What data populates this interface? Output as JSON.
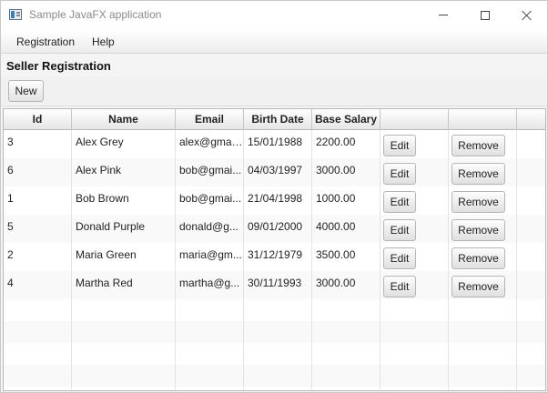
{
  "window": {
    "title": "Sample JavaFX application"
  },
  "menu": {
    "items": [
      "Registration",
      "Help"
    ]
  },
  "page": {
    "title": "Seller Registration",
    "new_label": "New"
  },
  "table": {
    "columns": [
      "Id",
      "Name",
      "Email",
      "Birth Date",
      "Base Salary",
      "",
      "",
      ""
    ],
    "rows": [
      {
        "id": "3",
        "name": "Alex Grey",
        "email": "alex@gmai...",
        "birth": "15/01/1988",
        "salary": "2200.00",
        "edit": "Edit",
        "remove": "Remove"
      },
      {
        "id": "6",
        "name": "Alex Pink",
        "email": "bob@gmai...",
        "birth": "04/03/1997",
        "salary": "3000.00",
        "edit": "Edit",
        "remove": "Remove"
      },
      {
        "id": "1",
        "name": "Bob Brown",
        "email": "bob@gmai...",
        "birth": "21/04/1998",
        "salary": "1000.00",
        "edit": "Edit",
        "remove": "Remove"
      },
      {
        "id": "5",
        "name": "Donald Purple",
        "email": "donald@g...",
        "birth": "09/01/2000",
        "salary": "4000.00",
        "edit": "Edit",
        "remove": "Remove"
      },
      {
        "id": "2",
        "name": "Maria Green",
        "email": "maria@gm...",
        "birth": "31/12/1979",
        "salary": "3500.00",
        "edit": "Edit",
        "remove": "Remove"
      },
      {
        "id": "4",
        "name": "Martha Red",
        "email": "martha@g...",
        "birth": "30/11/1993",
        "salary": "3000.00",
        "edit": "Edit",
        "remove": "Remove"
      }
    ]
  },
  "icons": {
    "app": "application-window-icon",
    "minimize": "minimize-icon",
    "maximize": "maximize-icon",
    "close": "close-icon"
  }
}
